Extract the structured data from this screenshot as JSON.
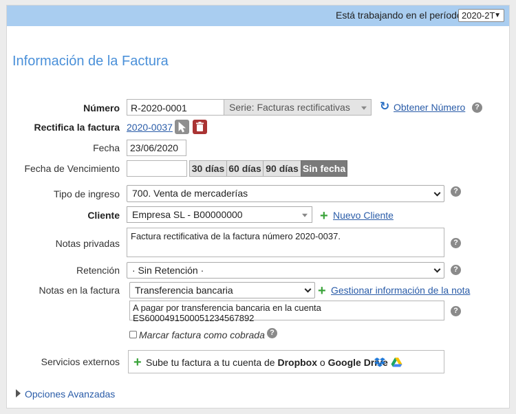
{
  "topbar": {
    "period_label": "Está trabajando en el período",
    "period_value": "2020-2T"
  },
  "page_title": "Información de la Factura",
  "numero": {
    "label": "Número",
    "value": "R-2020-0001",
    "serie": "Serie: Facturas rectificativas",
    "get_link": "Obtener Número"
  },
  "rectifica": {
    "label": "Rectifica la factura",
    "link": "2020-0037"
  },
  "fecha": {
    "label": "Fecha",
    "value": "23/06/2020"
  },
  "vencimiento": {
    "label": "Fecha de Vencimiento",
    "value": "",
    "buttons": [
      "30 días",
      "60 días",
      "90 días",
      "Sin fecha"
    ],
    "active": "Sin fecha"
  },
  "tipo_ingreso": {
    "label": "Tipo de ingreso",
    "value": "700. Venta de mercaderías"
  },
  "cliente": {
    "label": "Cliente",
    "value": "Empresa SL - B00000000",
    "new_link": "Nuevo Cliente"
  },
  "notas_privadas": {
    "label": "Notas privadas",
    "value": "Factura rectificativa de la factura número 2020-0037."
  },
  "retencion": {
    "label": "Retención",
    "value": "· Sin Retención ·"
  },
  "notas_factura": {
    "label": "Notas en la factura",
    "value": "Transferencia bancaria",
    "manage_link": "Gestionar información de la nota",
    "text": "A pagar por transferencia bancaria en la cuenta ES6000491500051234567892"
  },
  "cobrada": {
    "label": "Marcar factura como cobrada",
    "checked": false
  },
  "servicios": {
    "label": "Servicios externos",
    "prefix": "Sube tu factura a tu cuenta de",
    "dropbox": "Dropbox",
    "joiner": "o",
    "gdrive": "Google Drive"
  },
  "advanced": {
    "label": "Opciones Avanzadas"
  },
  "colors": {
    "topbar": "#a9cdf0",
    "title": "#4a90d9",
    "link": "#2a5ca8",
    "plus": "#3aa33a",
    "trash": "#c0392b"
  }
}
